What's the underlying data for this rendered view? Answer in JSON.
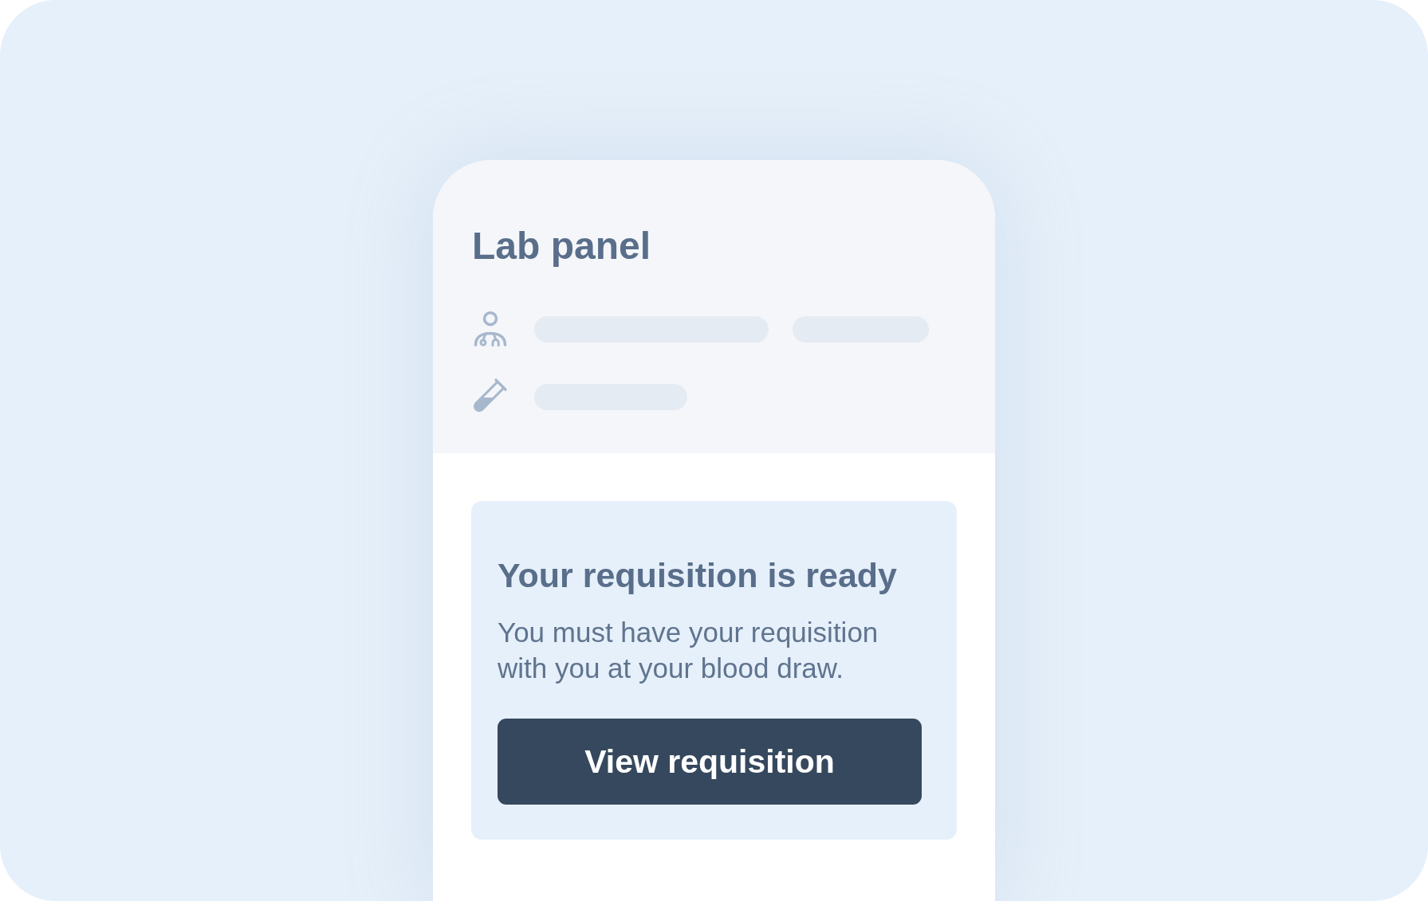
{
  "card": {
    "title": "Lab panel"
  },
  "notice": {
    "heading": "Your requisition is ready",
    "body": "You must have your requisition with you at your blood draw.",
    "button": "View requisition"
  }
}
